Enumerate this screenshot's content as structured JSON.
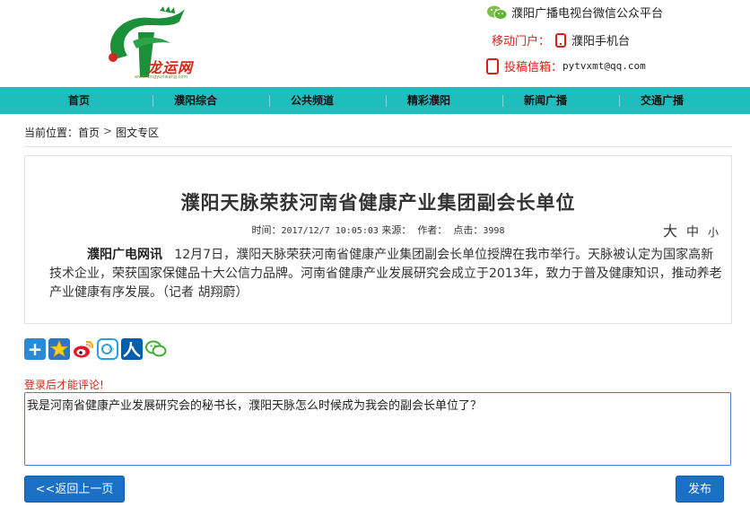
{
  "header": {
    "wechat_text": "濮阳广播电视台微信公众平台",
    "mobile_label": "移动门户：",
    "mobile_text": "濮阳手机台",
    "contribute_label": "投稿信箱：",
    "contribute_email": "pytvxmt@qq.com",
    "logo_text": "龙运网",
    "logo_sub": "www.longyunwang.com"
  },
  "nav": {
    "items": [
      "首页",
      "濮阳综合",
      "公共频道",
      "精彩濮阳",
      "新闻广播",
      "交通广播"
    ]
  },
  "breadcrumb": {
    "prefix": "当前位置：",
    "home": "首页",
    "separator": ">",
    "current": "图文专区"
  },
  "article": {
    "title": "濮阳天脉荣获河南省健康产业集团副会长单位",
    "meta": {
      "time_label": "时间：",
      "time_value": "2017/12/7 10:05:03",
      "source_label": "来源：",
      "author_label": "作者：",
      "clicks_label": "点击：",
      "clicks_value": "3998"
    },
    "font_size": {
      "large": "大",
      "medium": "中",
      "small": "小"
    },
    "lead": "濮阳广电网讯",
    "body": "12月7日，濮阳天脉荣获河南省健康产业集团副会长单位授牌在我市举行。天脉被认定为国家高新技术企业，荣获国家保健品十大公信力品牌。河南省健康产业发展研究会成立于2013年，致力于普及健康知识，推动养老产业健康有序发展。（记者 胡翔蔚）"
  },
  "share": {
    "icons": [
      "plus-icon",
      "star-icon",
      "weibo-icon",
      "tqq-icon",
      "renren-icon",
      "wechat-icon"
    ]
  },
  "comment": {
    "login_tip": "登录后才能评论!",
    "value": "我是河南省健康产业发展研究会的秘书长，濮阳天脉怎么时候成为我会的副会长单位了？"
  },
  "buttons": {
    "back": "<<返回上一页",
    "submit": "发布"
  },
  "colors": {
    "nav_bg": "#1fbdbc",
    "accent_red": "#d8211a",
    "button_blue": "#1a6fc6"
  }
}
